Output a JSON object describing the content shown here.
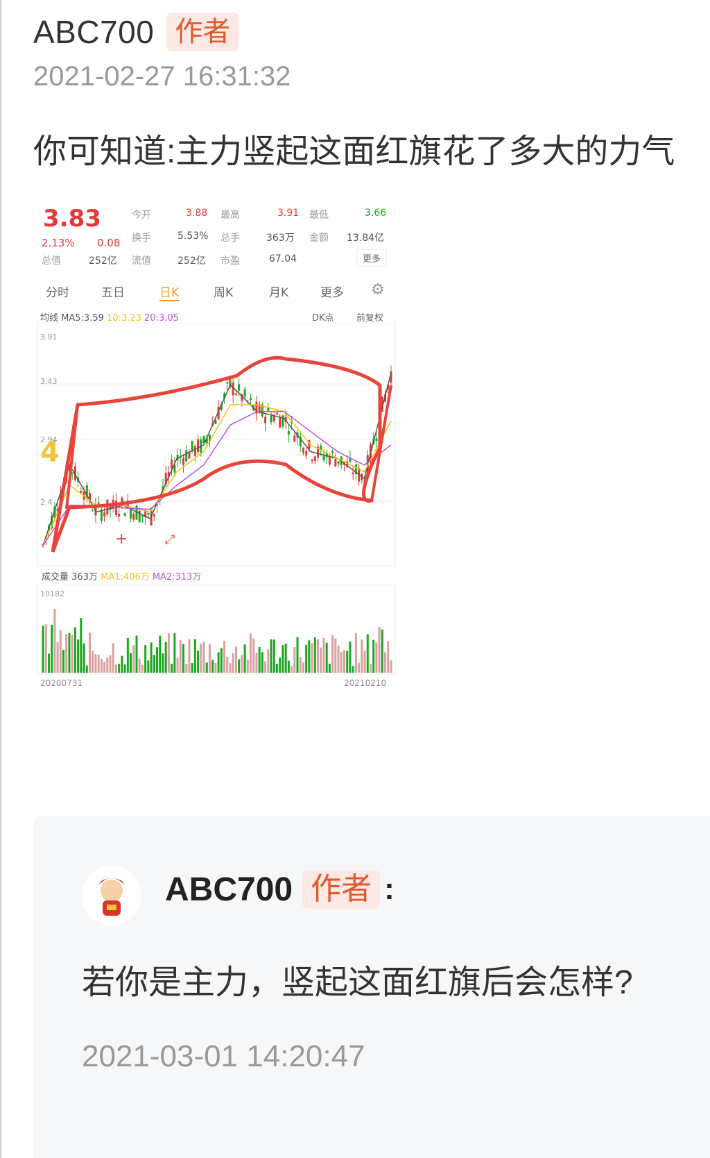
{
  "post": {
    "username": "ABC700",
    "author_tag": "作者",
    "timestamp": "2021-02-27 16:31:32",
    "text": "你可知道:主力竖起这面红旗花了多大的力气"
  },
  "stock": {
    "price": "3.83",
    "change_pct": "2.13%",
    "change_abs": "0.08",
    "stats": {
      "open_label": "今开",
      "open": "3.88",
      "high_label": "最高",
      "high": "3.91",
      "low_label": "最低",
      "low": "3.66",
      "turnover_label": "换手",
      "turnover": "5.53%",
      "volume_label": "总手",
      "volume": "363万",
      "amount_label": "金额",
      "amount": "13.84亿",
      "mktcap_label": "总值",
      "mktcap": "252亿",
      "float_label": "流值",
      "float": "252亿",
      "pe_label": "市盈",
      "pe": "67.04",
      "more": "更多"
    },
    "tabs": [
      "分时",
      "五日",
      "日K",
      "周K",
      "月K",
      "更多"
    ],
    "active_tab": "日K",
    "ma_line": {
      "label": "均线",
      "ma5": "MA5:3.59",
      "ma10": "10:3.23",
      "ma20": "20:3.05"
    },
    "dk_label": "DK点",
    "adj_label": "前复权",
    "y_ticks": [
      "3.91",
      "3.43",
      "2.94",
      "2.4"
    ],
    "volume_line": {
      "label": "成交量",
      "vol": "363万",
      "ma1": "MA1:406万",
      "ma2": "MA2:313万"
    },
    "vol_max": "10182",
    "date_start": "20200731",
    "date_end": "20210210",
    "colors": {
      "up": "#e03a3a",
      "down": "#19a81e",
      "ma5": "#555555",
      "ma10": "#f2c30f",
      "ma20": "#c04fd0",
      "marker": "#e8443a"
    }
  },
  "chart_data": {
    "type": "line",
    "title": "",
    "xlabel": "",
    "ylabel": "",
    "x": [
      "20200731",
      "20210210"
    ],
    "ylim": [
      2.2,
      3.91
    ],
    "series": [
      {
        "name": "MA5",
        "values": [
          2.3,
          2.9,
          2.55,
          2.6,
          2.5,
          2.95,
          3.05,
          3.5,
          3.3,
          3.25,
          3.0,
          2.95,
          2.8,
          3.59
        ]
      },
      {
        "name": "MA10",
        "values": [
          2.3,
          2.75,
          2.6,
          2.6,
          2.55,
          2.85,
          3.0,
          3.35,
          3.35,
          3.3,
          3.05,
          2.95,
          2.85,
          3.23
        ]
      },
      {
        "name": "MA20",
        "values": [
          2.3,
          2.6,
          2.6,
          2.58,
          2.57,
          2.75,
          2.9,
          3.2,
          3.3,
          3.3,
          3.15,
          3.0,
          2.9,
          3.05
        ]
      }
    ]
  },
  "reply": {
    "username": "ABC700",
    "author_tag": "作者",
    "colon": ":",
    "text": "若你是主力，竖起这面红旗后会怎样?",
    "timestamp": "2021-03-01 14:20:47"
  }
}
